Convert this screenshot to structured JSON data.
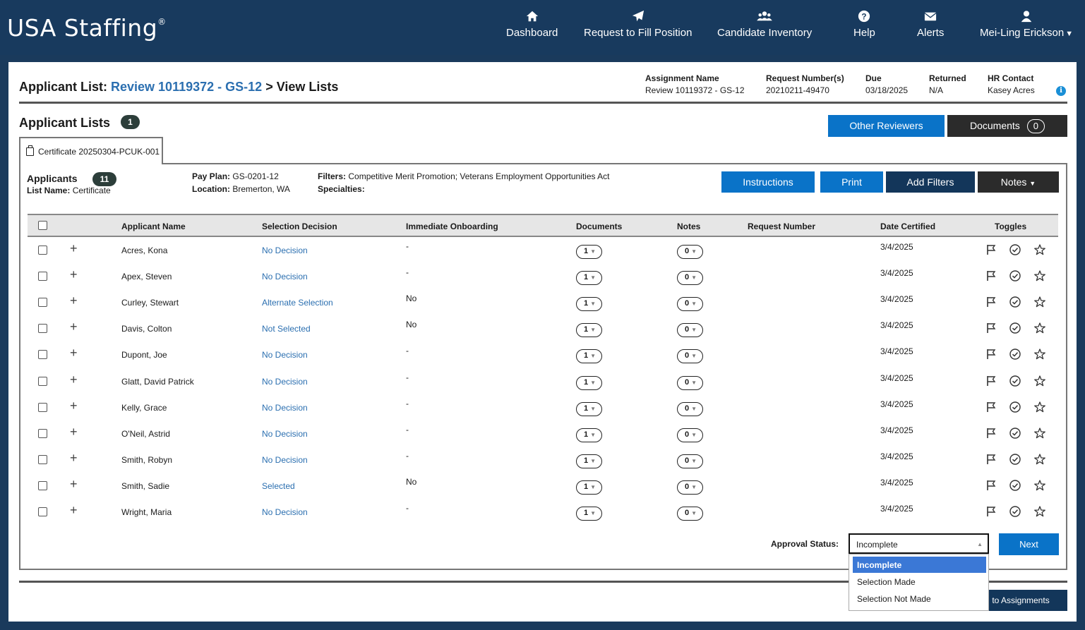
{
  "app": {
    "logo": "USA Staffing",
    "logo_mark": "®"
  },
  "nav": {
    "dashboard": "Dashboard",
    "request": "Request to Fill Position",
    "inventory": "Candidate Inventory",
    "help": "Help",
    "alerts": "Alerts",
    "user": "Mei-Ling Erickson"
  },
  "header": {
    "title_prefix": "Applicant List:",
    "title_link": "Review 10119372 - GS-12",
    "title_suffix": "> View Lists",
    "assignment_label": "Assignment Name",
    "assignment_value": "Review 10119372 - GS-12",
    "request_label": "Request Number(s)",
    "request_value": "20210211-49470",
    "due_label": "Due",
    "due_value": "03/18/2025",
    "returned_label": "Returned",
    "returned_value": "N/A",
    "hr_label": "HR Contact",
    "hr_value": "Kasey Acres"
  },
  "lists": {
    "title": "Applicant Lists",
    "count": "1",
    "other_reviewers": "Other Reviewers",
    "documents": "Documents",
    "documents_count": "0",
    "tab": "Certificate 20250304-PCUK-001"
  },
  "applicants": {
    "title": "Applicants",
    "count": "11",
    "list_name_label": "List Name:",
    "list_name": "Certificate",
    "pay_plan_label": "Pay Plan:",
    "pay_plan": "GS-0201-12",
    "location_label": "Location:",
    "location": "Bremerton, WA",
    "filters_label": "Filters:",
    "filters": "Competitive Merit Promotion; Veterans Employment Opportunities Act",
    "specialties_label": "Specialties:",
    "instructions": "Instructions",
    "print": "Print",
    "add_filters": "Add Filters",
    "notes": "Notes"
  },
  "table": {
    "headers": [
      "Applicant Name",
      "Selection Decision",
      "Immediate Onboarding",
      "Documents",
      "Notes",
      "Request Number",
      "Date Certified",
      "Toggles"
    ],
    "rows": [
      {
        "name": "Acres, Kona",
        "decision": "No Decision",
        "onboarding": "-",
        "docs": "1",
        "notes": "0",
        "date": "3/4/2025"
      },
      {
        "name": "Apex, Steven",
        "decision": "No Decision",
        "onboarding": "-",
        "docs": "1",
        "notes": "0",
        "date": "3/4/2025"
      },
      {
        "name": "Curley, Stewart",
        "decision": "Alternate Selection",
        "onboarding": "No",
        "docs": "1",
        "notes": "0",
        "date": "3/4/2025"
      },
      {
        "name": "Davis, Colton",
        "decision": "Not Selected",
        "onboarding": "No",
        "docs": "1",
        "notes": "0",
        "date": "3/4/2025"
      },
      {
        "name": "Dupont, Joe",
        "decision": "No Decision",
        "onboarding": "-",
        "docs": "1",
        "notes": "0",
        "date": "3/4/2025"
      },
      {
        "name": "Glatt, David Patrick",
        "decision": "No Decision",
        "onboarding": "-",
        "docs": "1",
        "notes": "0",
        "date": "3/4/2025"
      },
      {
        "name": "Kelly, Grace",
        "decision": "No Decision",
        "onboarding": "-",
        "docs": "1",
        "notes": "0",
        "date": "3/4/2025"
      },
      {
        "name": "O'Neil, Astrid",
        "decision": "No Decision",
        "onboarding": "-",
        "docs": "1",
        "notes": "0",
        "date": "3/4/2025"
      },
      {
        "name": "Smith, Robyn",
        "decision": "No Decision",
        "onboarding": "-",
        "docs": "1",
        "notes": "0",
        "date": "3/4/2025"
      },
      {
        "name": "Smith, Sadie",
        "decision": "Selected",
        "onboarding": "No",
        "docs": "1",
        "notes": "0",
        "date": "3/4/2025"
      },
      {
        "name": "Wright, Maria",
        "decision": "No Decision",
        "onboarding": "-",
        "docs": "1",
        "notes": "0",
        "date": "3/4/2025"
      }
    ]
  },
  "approval": {
    "label": "Approval Status:",
    "value": "Incomplete",
    "options": [
      "Incomplete",
      "Selection Made",
      "Selection Not Made"
    ],
    "next": "Next",
    "back": "to Assignments"
  }
}
